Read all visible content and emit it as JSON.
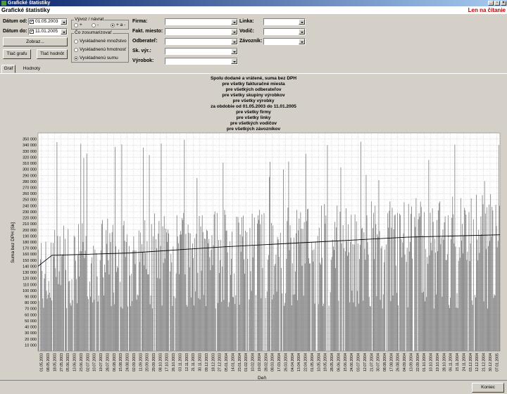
{
  "window": {
    "title": "Grafické štatistiky"
  },
  "menubar": {
    "app_title": "Grafické štatistiky",
    "mode": "Len na čítanie"
  },
  "filters": {
    "date_from_label": "Dátum od:",
    "date_from_value": "01.05.2003",
    "date_to_label": "Dátum do:",
    "date_to_value": "11.01.2005",
    "show_button": "Zobraz...",
    "print_chart_button": "Tlač grafu",
    "print_values_button": "Tlač hodnôt",
    "export_group": {
      "title": "Vývoz / návrat",
      "options": [
        "+",
        "-",
        "+ a -"
      ],
      "selected": 2
    },
    "sum_group": {
      "title": "Čo zosumarizovať",
      "options": [
        "Vyskladnené množstvo",
        "Vyskladnenú hmotnosť",
        "Vyskladnenú sumu"
      ],
      "selected": 2
    },
    "firma_label": "Firma:",
    "fakt_miesto_label": "Fakt. miesto:",
    "odberatel_label": "Odberateľ:",
    "sk_vyr_label": "Sk. výr.:",
    "vyrobok_label": "Výrobok:",
    "linka_label": "Linka:",
    "vodic_label": "Vodič:",
    "zavoznik_label": "Závozník:"
  },
  "tabs": [
    {
      "label": "Graf"
    },
    {
      "label": "Hodnoty"
    }
  ],
  "chart_data": {
    "type": "bar",
    "title_lines": [
      "Spolu dodané a vrátené, suma bez DPH",
      "pre všetky fakturačné miesta",
      "pre všetkých odberateľov",
      "pre všetky skupiny výrobkov",
      "pre všetky výrobky",
      "za obdobie od 01.05.2003 do 11.01.2005",
      "pre všetky firmy",
      "pre všetky linky",
      "pre všetkých vodičov",
      "pre všetkých závozníkov"
    ],
    "xlabel": "Deň",
    "ylabel": "Suma bez DPH [Sk]",
    "ylim": [
      0,
      360000
    ],
    "y_ticks": [
      10000,
      20000,
      30000,
      40000,
      50000,
      60000,
      70000,
      80000,
      90000,
      100000,
      110000,
      120000,
      130000,
      140000,
      150000,
      160000,
      170000,
      180000,
      190000,
      200000,
      210000,
      220000,
      230000,
      240000,
      250000,
      260000,
      270000,
      280000,
      290000,
      300000,
      310000,
      320000,
      330000,
      340000,
      350000
    ],
    "x_ticks": [
      "01.05.2003",
      "08.05.2003",
      "18.05.2003",
      "27.05.2003",
      "05.06.2003",
      "13.06.2003",
      "23.06.2003",
      "02.07.2003",
      "10.07.2003",
      "19.07.2003",
      "28.07.2003",
      "06.08.2003",
      "15.08.2003",
      "24.08.2003",
      "02.09.2003",
      "11.09.2003",
      "20.09.2003",
      "29.09.2003",
      "08.10.2003",
      "17.10.2003",
      "26.10.2003",
      "03.11.2003",
      "12.11.2003",
      "21.11.2003",
      "30.11.2003",
      "09.12.2003",
      "18.12.2003",
      "27.12.2003",
      "05.01.2004",
      "14.01.2004",
      "23.01.2004",
      "01.02.2004",
      "10.02.2004",
      "19.02.2004",
      "28.02.2004",
      "08.03.2004",
      "17.03.2004",
      "26.03.2004",
      "04.04.2004",
      "13.04.2004",
      "22.04.2004",
      "01.05.2004",
      "10.05.2004",
      "19.05.2004",
      "28.05.2004",
      "06.06.2004",
      "15.06.2004",
      "24.06.2004",
      "03.07.2004",
      "12.07.2004",
      "21.07.2004",
      "30.07.2004",
      "08.08.2004",
      "17.08.2004",
      "26.08.2004",
      "04.09.2004",
      "13.09.2004",
      "22.09.2004",
      "01.10.2004",
      "10.10.2004",
      "19.10.2004",
      "28.10.2004",
      "06.11.2004",
      "15.11.2004",
      "24.11.2004",
      "03.12.2004",
      "12.12.2004",
      "21.12.2004",
      "30.12.2004",
      "07.01.2005"
    ],
    "trend": [
      [
        0,
        140000
      ],
      [
        0.03,
        158000
      ],
      [
        0.2,
        162000
      ],
      [
        0.4,
        172000
      ],
      [
        0.6,
        180000
      ],
      [
        0.8,
        188000
      ],
      [
        1.0,
        192000
      ]
    ],
    "grid": true,
    "series_color": "#808080",
    "trend_color": "#000000"
  },
  "footer": {
    "close_button": "Koniec"
  }
}
